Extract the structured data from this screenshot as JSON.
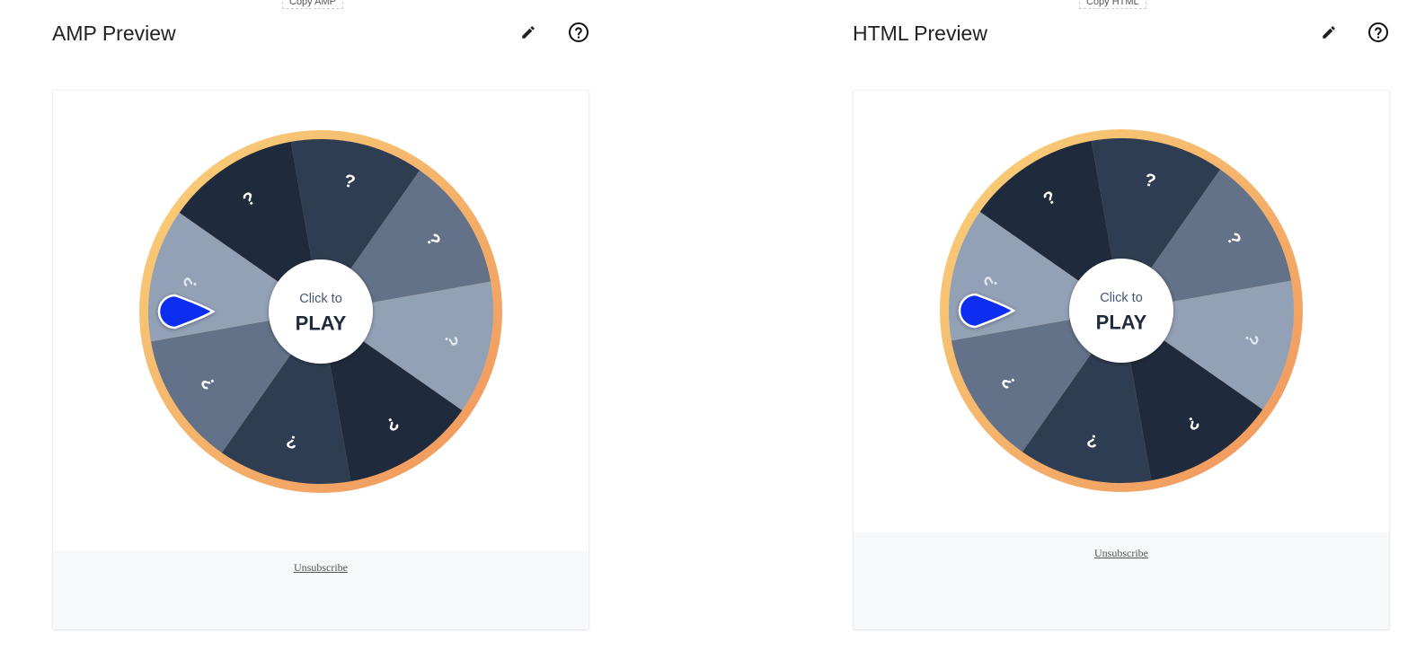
{
  "colors": {
    "segment_dark": "#1f2a3c",
    "segment_mid_dark": "#2f3d52",
    "segment_mid": "#637288",
    "segment_light": "#93a1b7",
    "rim_start": "#f9d27a",
    "rim_end": "#f0945c",
    "pointer": "#0a2ff0",
    "center_text_small": "#46566f",
    "center_text_big": "#1f2a3c"
  },
  "panels": [
    {
      "copy_label": "Copy AMP",
      "title": "AMP Preview",
      "edit_icon": "pencil-icon",
      "help_icon": "help-circle-icon",
      "center_small": "Click to",
      "center_big": "PLAY",
      "unsubscribe": "Unsubscribe"
    },
    {
      "copy_label": "Copy HTML",
      "title": "HTML Preview",
      "edit_icon": "pencil-icon",
      "help_icon": "help-circle-icon",
      "center_small": "Click to",
      "center_big": "PLAY",
      "unsubscribe": "Unsubscribe"
    }
  ],
  "wheel": {
    "segments": [
      {
        "label": "?",
        "color": "segment_mid_dark"
      },
      {
        "label": "?",
        "color": "segment_mid"
      },
      {
        "label": "?",
        "color": "segment_light"
      },
      {
        "label": "?",
        "color": "segment_dark"
      },
      {
        "label": "?",
        "color": "segment_mid_dark"
      },
      {
        "label": "?",
        "color": "segment_mid"
      },
      {
        "label": "?",
        "color": "segment_light"
      },
      {
        "label": "?",
        "color": "segment_dark"
      }
    ]
  }
}
